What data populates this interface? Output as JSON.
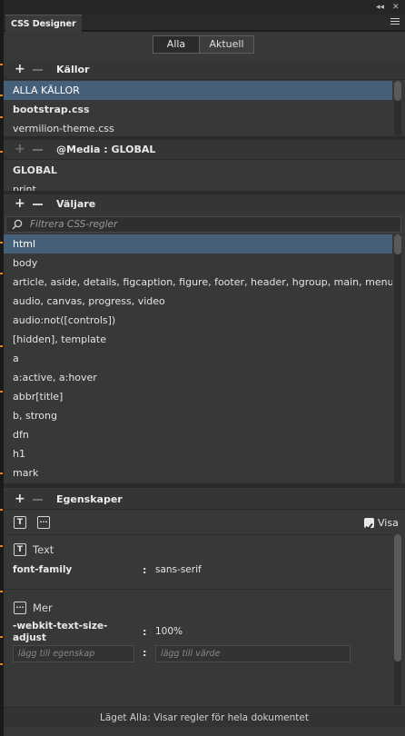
{
  "panel": {
    "tab_label": "CSS Designer"
  },
  "mode": {
    "all": "Alla",
    "current": "Aktuell"
  },
  "sources": {
    "title": "Källor",
    "items": [
      "ALLA KÄLLOR",
      "bootstrap.css",
      "vermilion-theme.css"
    ]
  },
  "media": {
    "title": "@Media :  GLOBAL",
    "items": [
      "GLOBAL",
      "print"
    ]
  },
  "selectors": {
    "title": "Väljare",
    "filter_placeholder": "Filtrera CSS-regler",
    "items": [
      "html",
      "body",
      "article, aside, details, figcaption, figure, footer, header, hgroup, main, menu, ...",
      "audio, canvas, progress, video",
      "audio:not([controls])",
      "[hidden], template",
      "a",
      "a:active, a:hover",
      "abbr[title]",
      "b, strong",
      "dfn",
      "h1",
      "mark"
    ]
  },
  "properties": {
    "title": "Egenskaper",
    "show_label": "Visa",
    "text_section": "Text",
    "font_family_name": "font-family",
    "font_family_value": "sans-serif",
    "more_section": "Mer",
    "webkit_name": "-webkit-text-size-adjust",
    "webkit_value": "100%",
    "add_property_placeholder": "lägg till egenskap",
    "add_value_placeholder": "lägg till värde"
  },
  "status": "Läget Alla: Visar regler för hela dokumentet",
  "colors": {
    "selection": "#46607a",
    "panel": "#383838"
  }
}
